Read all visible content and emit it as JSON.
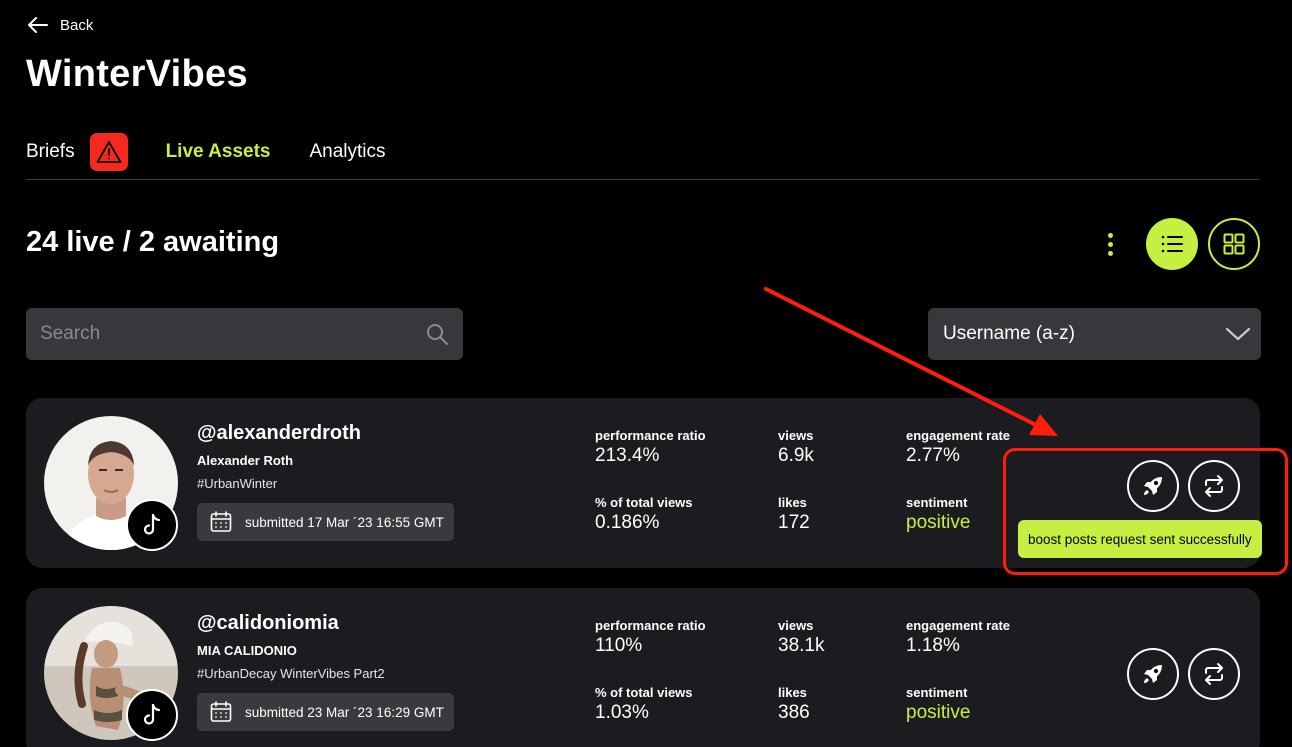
{
  "header": {
    "back_label": "Back",
    "title": "WinterVibes"
  },
  "tabs": [
    {
      "label": "Briefs",
      "active": false,
      "badge_icon": "warning-icon"
    },
    {
      "label": "Live Assets",
      "active": true
    },
    {
      "label": "Analytics",
      "active": false
    }
  ],
  "summary": {
    "count_text": "24 live / 2 awaiting"
  },
  "toolbar": {
    "more_icon": "more-vertical-icon",
    "list_view_icon": "list-view-icon",
    "grid_view_icon": "grid-view-icon",
    "active_view": "list"
  },
  "search": {
    "placeholder": "Search",
    "value": ""
  },
  "sort": {
    "selected": "Username (a-z)"
  },
  "labels": {
    "performance_ratio": "performance ratio",
    "views": "views",
    "engagement_rate": "engagement rate",
    "pct_total_views": "% of total views",
    "likes": "likes",
    "sentiment": "sentiment"
  },
  "assets": [
    {
      "handle": "@alexanderdroth",
      "name": "Alexander Roth",
      "hashtags": "#UrbanWinter",
      "submitted": "submitted 17 Mar ´23 16:55 GMT",
      "platform_icon": "tiktok-icon",
      "performance_ratio": "213.4%",
      "views": "6.9k",
      "engagement_rate": "2.77%",
      "pct_total_views": "0.186%",
      "likes": "172",
      "sentiment": "positive",
      "toast": "boost posts request sent successfully"
    },
    {
      "handle": "@calidoniomia",
      "name": "MIA CALIDONIO",
      "hashtags": "#UrbanDecay WinterVibes Part2",
      "submitted": "submitted 23 Mar ´23 16:29 GMT",
      "platform_icon": "tiktok-icon",
      "performance_ratio": "110%",
      "views": "38.1k",
      "engagement_rate": "1.18%",
      "pct_total_views": "1.03%",
      "likes": "386",
      "sentiment": "positive"
    }
  ],
  "colors": {
    "accent": "#c5f041",
    "background": "#000000",
    "card": "#1c1c20",
    "input": "#38383c",
    "warning": "#f5291d",
    "annotation": "#ff1d0c"
  }
}
